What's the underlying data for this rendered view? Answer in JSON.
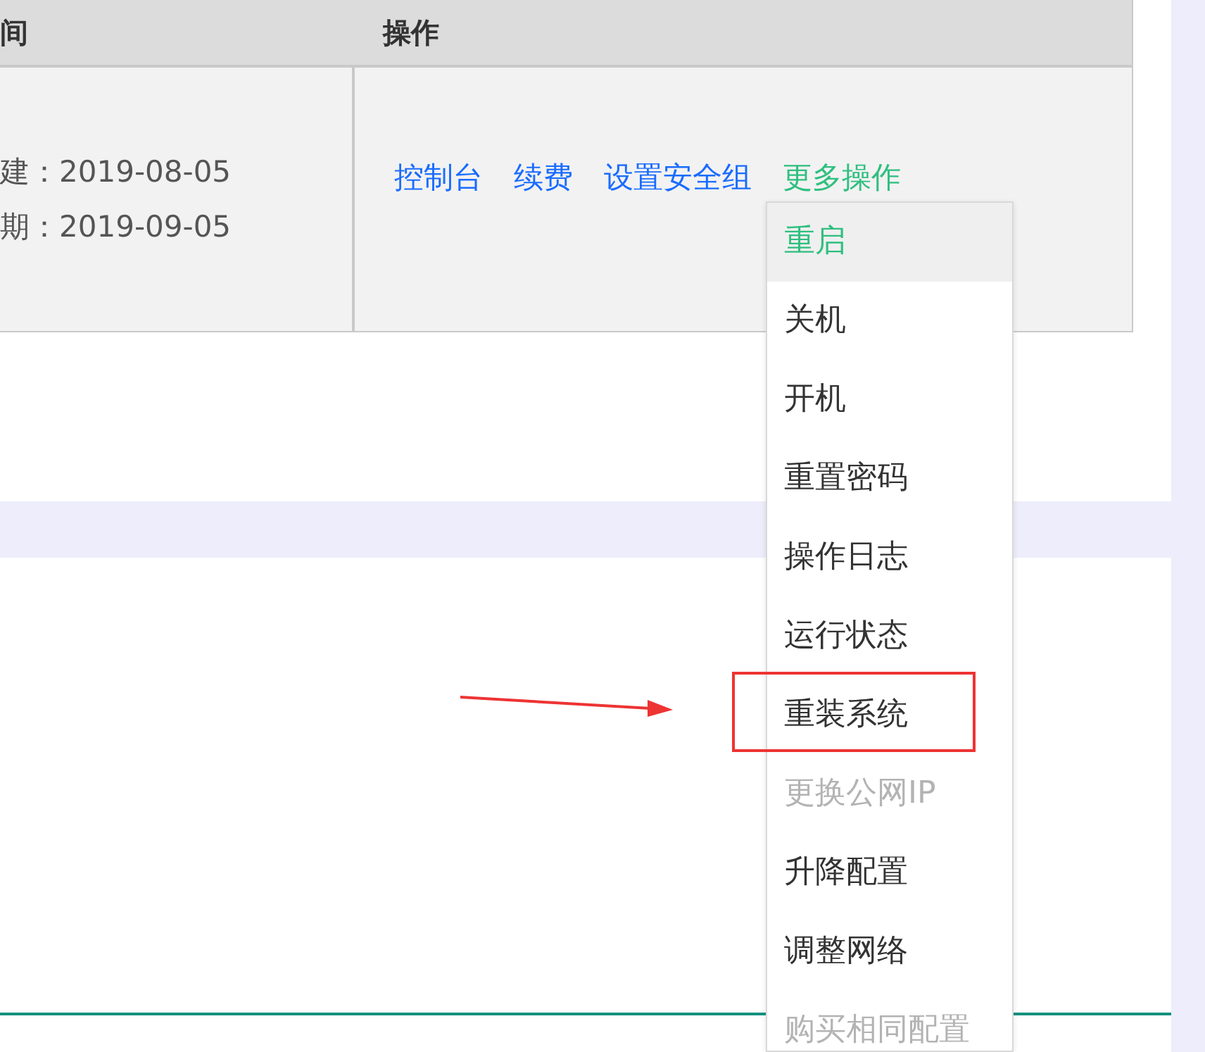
{
  "table": {
    "columns": [
      "间",
      "操作"
    ],
    "rows": [
      {
        "dates": [
          "建：2019-08-05",
          "期：2019-09-05"
        ],
        "actions": [
          {
            "label": "控制台",
            "kind": "link"
          },
          {
            "label": "续费",
            "kind": "link"
          },
          {
            "label": "设置安全组",
            "kind": "link"
          },
          {
            "label": "更多操作",
            "kind": "menu"
          }
        ]
      }
    ]
  },
  "dropdown": {
    "items": [
      {
        "label": "重启",
        "selected": true,
        "disabled": false,
        "highlighted": false
      },
      {
        "label": "关机",
        "selected": false,
        "disabled": false,
        "highlighted": false
      },
      {
        "label": "开机",
        "selected": false,
        "disabled": false,
        "highlighted": false
      },
      {
        "label": "重置密码",
        "selected": false,
        "disabled": false,
        "highlighted": false
      },
      {
        "label": "操作日志",
        "selected": false,
        "disabled": false,
        "highlighted": false
      },
      {
        "label": "运行状态",
        "selected": false,
        "disabled": false,
        "highlighted": false
      },
      {
        "label": "重装系统",
        "selected": false,
        "disabled": false,
        "highlighted": true
      },
      {
        "label": "更换公网IP",
        "selected": false,
        "disabled": true,
        "highlighted": false
      },
      {
        "label": "升降配置",
        "selected": false,
        "disabled": false,
        "highlighted": false
      },
      {
        "label": "调整网络",
        "selected": false,
        "disabled": false,
        "highlighted": false
      },
      {
        "label": "购买相同配置",
        "selected": false,
        "disabled": true,
        "highlighted": false
      }
    ]
  }
}
